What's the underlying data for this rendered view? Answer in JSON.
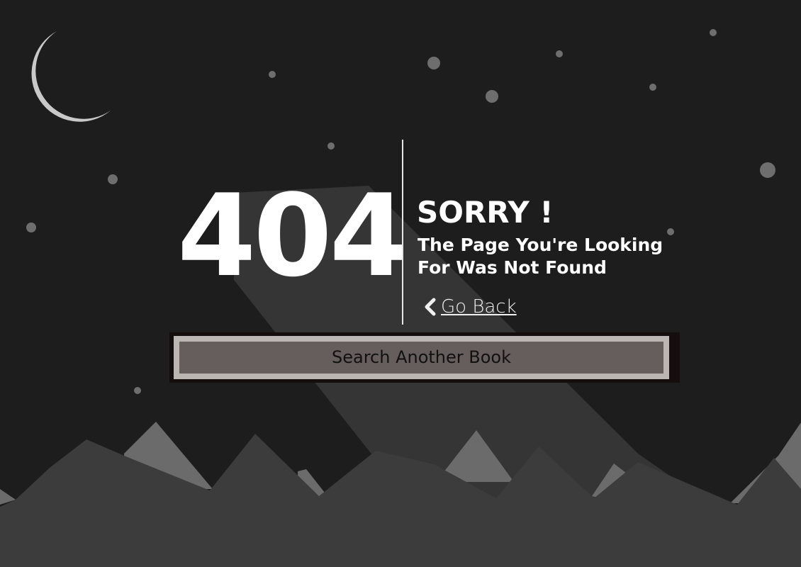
{
  "error": {
    "code": "404",
    "heading": "SORRY !",
    "message": "The Page You're Looking For Was Not Found"
  },
  "nav": {
    "back_label": "Go Back",
    "back_icon": "chevron-left-icon"
  },
  "actions": {
    "search_label": "Search Another Book"
  },
  "decor": {
    "moon_icon": "crescent-moon-icon",
    "colors": {
      "background": "#1d1d1d",
      "moon": "#c9c9c9",
      "stars": "#6a6a6a",
      "light_beam": "#3a3a3a",
      "mountains_dark": "#3d3d3d",
      "mountains_light": "#6b6b6b",
      "button_fill": "#655e5c",
      "button_border": "#bcb6b3"
    }
  }
}
